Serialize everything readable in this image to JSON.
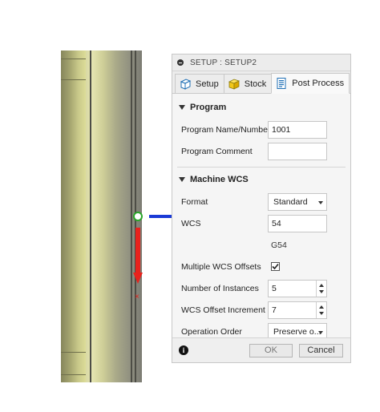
{
  "dialog": {
    "title": "SETUP : SETUP2",
    "tabs": [
      {
        "label": "Setup",
        "icon": "setup-cube-icon"
      },
      {
        "label": "Stock",
        "icon": "stock-box-icon"
      },
      {
        "label": "Post Process",
        "icon": "post-process-icon",
        "active": true
      }
    ],
    "program": {
      "heading": "Program",
      "name_label": "Program Name/Number",
      "name_value": "1001",
      "comment_label": "Program Comment",
      "comment_value": ""
    },
    "machine_wcs": {
      "heading": "Machine WCS",
      "format_label": "Format",
      "format_value": "Standard",
      "wcs_label": "WCS",
      "wcs_value": "54",
      "wcs_code": "G54",
      "multiple_label": "Multiple WCS Offsets",
      "multiple_checked": true,
      "instances_label": "Number of Instances",
      "instances_value": "5",
      "increment_label": "WCS Offset Increment",
      "increment_value": "7",
      "order_label": "Operation Order",
      "order_value": "Preserve o..."
    },
    "footer": {
      "ok_label": "OK",
      "cancel_label": "Cancel"
    }
  },
  "colors": {
    "axis_x": "#1a3ad6",
    "axis_z": "#e8221d",
    "origin": "#2aa62a",
    "part_face": "#d9d9a5"
  }
}
